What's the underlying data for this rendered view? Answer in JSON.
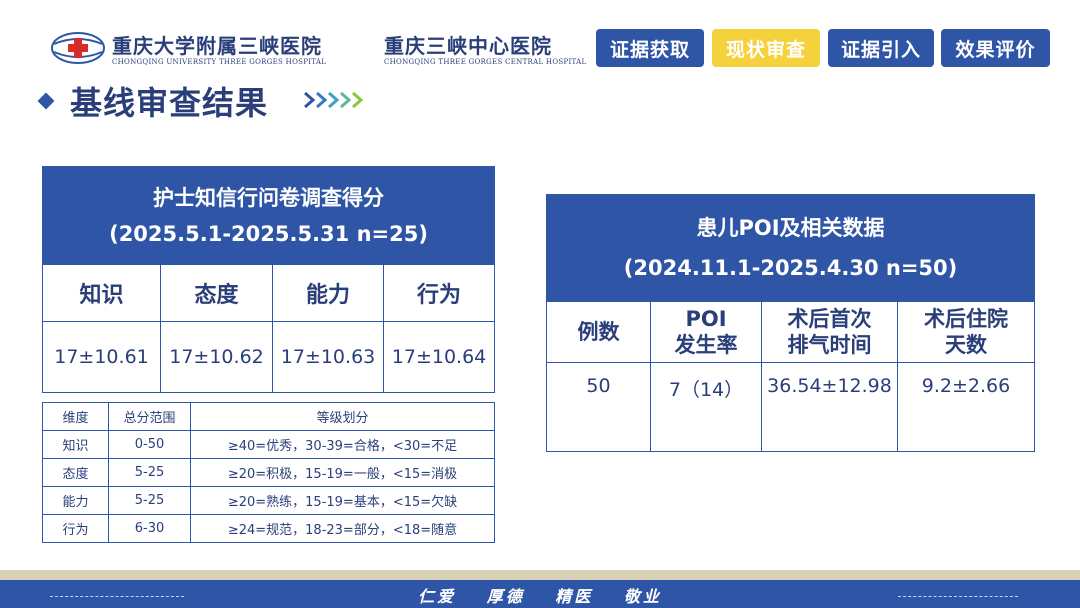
{
  "header": {
    "hospital1_cn": "重庆大学附属三峡医院",
    "hospital1_en": "CHONGQING UNIVERSITY THREE GORGES HOSPITAL",
    "hospital2_cn": "重庆三峡中心医院",
    "hospital2_en": "CHONGQING THREE GORGES CENTRAL HOSPITAL",
    "tabs": [
      {
        "label": "证据获取",
        "active": false
      },
      {
        "label": "现状审查",
        "active": true
      },
      {
        "label": "证据引入",
        "active": false
      },
      {
        "label": "效果评价",
        "active": false
      }
    ],
    "logo_icon": "hospital-logo-icon"
  },
  "section": {
    "title": "基线审查结果",
    "marker_icon": "diamond-icon",
    "arrow_icon": "chevrons-right-icon"
  },
  "nurse_table": {
    "title": "护士知信行问卷调查得分",
    "subtitle": "(2025.5.1-2025.5.31  n=25)",
    "columns": [
      "知识",
      "态度",
      "能力",
      "行为"
    ],
    "values": [
      "17±10.61",
      "17±10.62",
      "17±10.63",
      "17±10.64"
    ]
  },
  "poi_table": {
    "title": "患儿POI及相关数据",
    "subtitle": "(2024.11.1-2025.4.30  n=50)",
    "columns": [
      {
        "line1": "例数",
        "line2": ""
      },
      {
        "line1": "POI",
        "line2": "发生率"
      },
      {
        "line1": "术后首次",
        "line2": "排气时间"
      },
      {
        "line1": "术后住院",
        "line2": "天数"
      }
    ],
    "values": [
      "50",
      "7（14）",
      "36.54±12.98",
      "9.2±2.66"
    ]
  },
  "grade_table": {
    "headers": [
      "维度",
      "总分范围",
      "等级划分"
    ],
    "rows": [
      [
        "知识",
        "0-50",
        "≥40=优秀，30-39=合格，<30=不足"
      ],
      [
        "态度",
        "5-25",
        "≥20=积极，15-19=一般，<15=消极"
      ],
      [
        "能力",
        "5-25",
        "≥20=熟练，15-19=基本，<15=欠缺"
      ],
      [
        "行为",
        "6-30",
        "≥24=规范，18-23=部分，<18=随意"
      ]
    ]
  },
  "footer": {
    "motto": "仁爱 厚德 精医 敬业"
  },
  "colors": {
    "primary": "#2f56a6",
    "accent": "#f5d13c",
    "text": "#2a3f7a",
    "footer_band": "#d9d0b8"
  }
}
